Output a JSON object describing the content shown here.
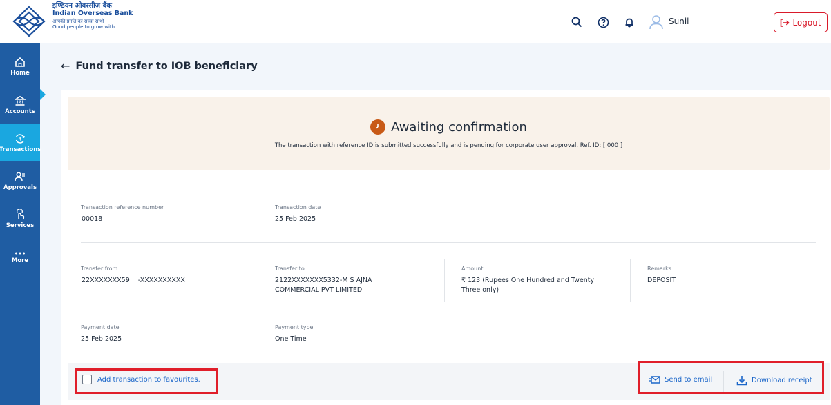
{
  "brand": {
    "hindi_name": "इण्डियन ओवरसीज़ बैंक",
    "english_name": "Indian Overseas Bank",
    "hindi_tagline": "आपकी प्रगति का सच्चा साथी",
    "tagline": "Good people to grow with"
  },
  "header": {
    "icons": [
      "search-icon",
      "help-icon",
      "bell-icon",
      "user-icon"
    ],
    "user_name": "Sunil",
    "logout_label": "Logout"
  },
  "sidebar": {
    "items": [
      {
        "label": "Home",
        "icon": "home-icon"
      },
      {
        "label": "Accounts",
        "icon": "bank-icon"
      },
      {
        "label": "Transactions",
        "icon": "rupee-cycle-icon",
        "active": true
      },
      {
        "label": "Approvals",
        "icon": "approvals-icon"
      },
      {
        "label": "Services",
        "icon": "services-icon"
      },
      {
        "label": "More",
        "icon": "more-dots-icon"
      }
    ]
  },
  "page": {
    "title": "Fund transfer to IOB beneficiary"
  },
  "status": {
    "title": "Awaiting confirmation",
    "message": "The transaction with reference ID is submitted successfully and is pending for corporate user approval. Ref. ID: [  000      ]"
  },
  "details": {
    "ref_label": "Transaction reference number",
    "ref_value": "00018",
    "date_label": "Transaction date",
    "date_value": "25 Feb 2025",
    "from_label": "Transfer from",
    "from_value": "22XXXXXXX59    -XXXXXXXXXX",
    "to_label": "Transfer to",
    "to_value_line1": "2122XXXXXXX5332-M S AJNA",
    "to_value_line2": "COMMERCIAL PVT LIMITED",
    "amount_label": "Amount",
    "amount_line1": "₹ 123 (Rupees One Hundred and Twenty",
    "amount_line2": "Three  only)",
    "remarks_label": "Remarks",
    "remarks_value": "DEPOSIT",
    "payment_date_label": "Payment date",
    "payment_date_value": "25 Feb 2025",
    "payment_type_label": "Payment type",
    "payment_type_value": "One Time"
  },
  "footer": {
    "favourite_label": "Add transaction to favourites.",
    "send_email_label": "Send to email",
    "download_label": "Download receipt"
  },
  "colors": {
    "sidebar": "#1f5da3",
    "sidebar_active": "#1aa7e0",
    "status_bg": "#f9f2ea",
    "status_icon": "#c85a17",
    "link": "#1b66c9",
    "logout": "#d91a2a",
    "highlight": "#e01e2a"
  }
}
